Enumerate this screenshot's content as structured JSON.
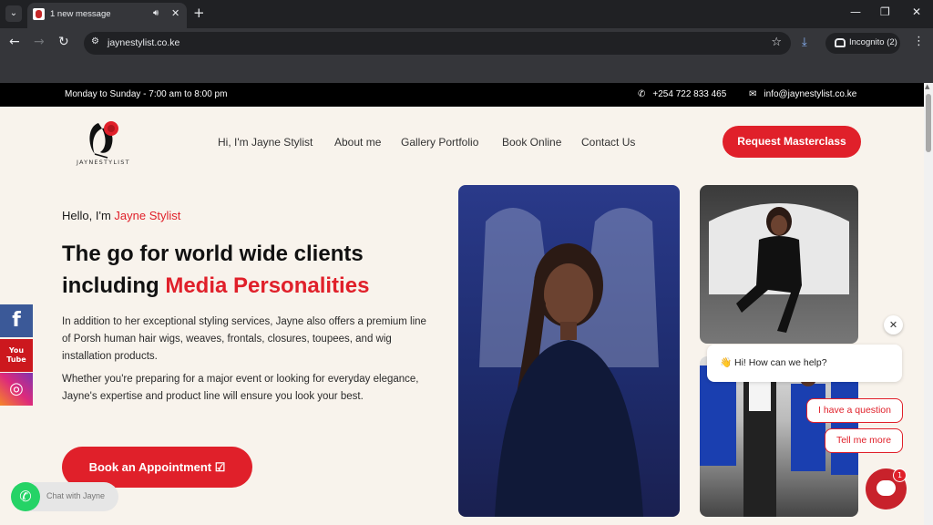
{
  "browser": {
    "tab_title": "1 new message",
    "url": "jaynestylist.co.ke",
    "incognito_label": "Incognito (2)",
    "icons": [
      "tab-search-icon",
      "audio-icon",
      "close-icon",
      "new-tab-icon",
      "back-icon",
      "forward-icon",
      "reload-icon",
      "site-info-icon",
      "star-icon",
      "download-icon",
      "incognito-icon",
      "menu-icon",
      "minimize-icon",
      "restore-icon"
    ]
  },
  "topbar": {
    "hours": "Monday to Sunday - 7:00 am to 8:00 pm",
    "phone": "+254 722 833 465",
    "email": "info@jaynestylist.co.ke"
  },
  "header": {
    "logo_text": "JAYNESTYLIST",
    "nav": [
      "Hi, I'm Jayne Stylist",
      "About me",
      "Gallery Portfolio",
      "Book Online",
      "Contact Us"
    ],
    "cta": "Request Masterclass"
  },
  "hero": {
    "hello_prefix": "Hello, I'm ",
    "hello_name": "Jayne Stylist",
    "headline_line1": "The go for world wide clients",
    "headline_prefix2": "including ",
    "headline_highlight": "Media Personalities",
    "paragraph1": "In addition to her exceptional styling services, Jayne also offers a premium line of Porsh human hair wigs, weaves, frontals, closures, toupees, and wig installation products.",
    "paragraph2": "Whether you're preparing for a major event or looking for everyday elegance, Jayne's expertise and product line will ensure you look your best.",
    "button": "Book an Appointment"
  },
  "social": {
    "youtube_line1": "You",
    "youtube_line2": "Tube"
  },
  "whatsapp": {
    "label": "Chat with Jayne"
  },
  "chat": {
    "greeting": "👋 Hi! How can we help?",
    "option1": "I have a question",
    "option2": "Tell me more",
    "badge": "1"
  },
  "colors": {
    "accent": "#e0202a",
    "page_bg": "#f8f3ec",
    "topbar_bg": "#000000"
  }
}
